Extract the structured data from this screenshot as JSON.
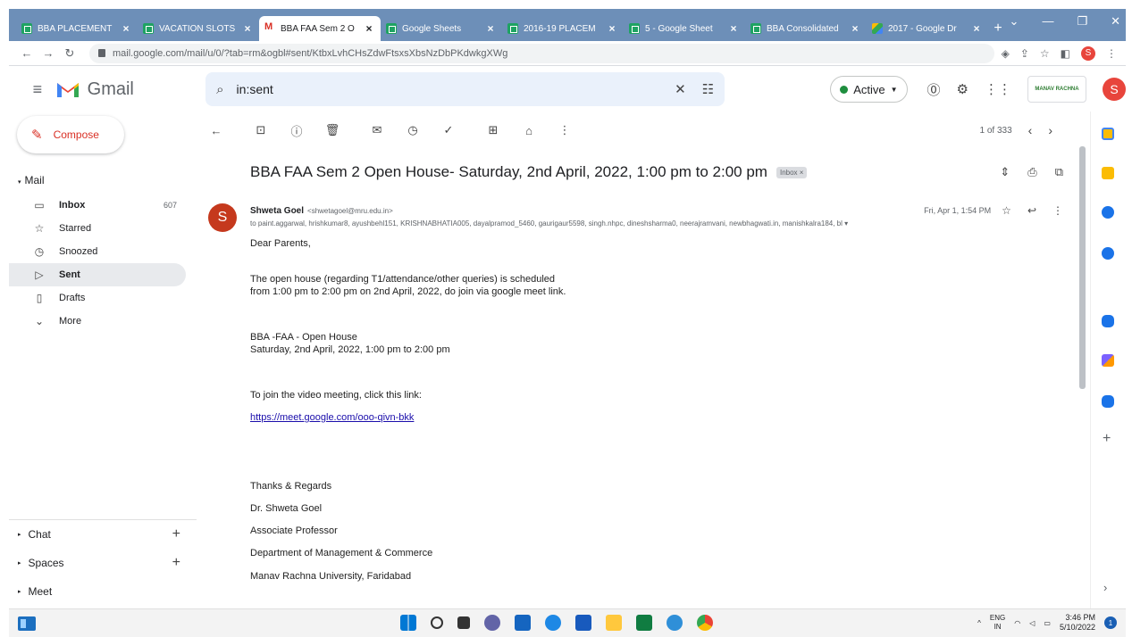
{
  "browser": {
    "tabs": [
      {
        "label": "BBA PLACEMENT",
        "icon": "sheets"
      },
      {
        "label": "VACATION SLOTS",
        "icon": "sheets"
      },
      {
        "label": "BBA FAA Sem 2 O",
        "icon": "gmail"
      },
      {
        "label": "Google Sheets",
        "icon": "sheets"
      },
      {
        "label": "2016-19 PLACEM",
        "icon": "sheets"
      },
      {
        "label": "5 - Google Sheet",
        "icon": "sheets"
      },
      {
        "label": "BBA Consolidated",
        "icon": "sheets"
      },
      {
        "label": "2017 - Google Dr",
        "icon": "drive"
      }
    ],
    "active_tab": 2,
    "new_tab": "+",
    "url": "mail.google.com/mail/u/0/?tab=rm&ogbl#sent/KtbxLvhCHsZdwFtsxsXbsNzDbPKdwkgXWg",
    "profile_initial": "S"
  },
  "gmail": {
    "app_name": "Gmail",
    "search_value": "in:sent",
    "status": "Active",
    "avatar_initial": "S",
    "org_logo_text": "MANAV RACHNA"
  },
  "sidebar": {
    "compose": "Compose",
    "mail_section": "Mail",
    "items": [
      {
        "label": "Inbox",
        "count": "607",
        "icon": "inbox-icon"
      },
      {
        "label": "Starred",
        "count": "",
        "icon": "star-icon"
      },
      {
        "label": "Snoozed",
        "count": "",
        "icon": "clock-icon"
      },
      {
        "label": "Sent",
        "count": "",
        "icon": "send-icon"
      },
      {
        "label": "Drafts",
        "count": "",
        "icon": "draft-icon"
      },
      {
        "label": "More",
        "count": "",
        "icon": "chevron-down-icon"
      }
    ],
    "bottom": [
      {
        "label": "Chat"
      },
      {
        "label": "Spaces"
      },
      {
        "label": "Meet"
      }
    ]
  },
  "toolbar": {
    "page_info": "1 of 333"
  },
  "message": {
    "subject": "BBA FAA Sem 2 Open House- Saturday, 2nd April, 2022, 1:00 pm to 2:00 pm",
    "label": "Inbox ×",
    "sender_initial": "S",
    "sender_name": "Shweta Goel",
    "sender_email": "<shwetagoel@mru.edu.in>",
    "time": "Fri, Apr 1, 1:54 PM",
    "recipients": "to paint.aggarwal, hrishkumar8, ayushbehl151, KRISHNABHATIA005, dayalpramod_5460, gaurigaur5598, singh.nhpc, dineshsharma0, neerajramvani, newbhagwati.in, manishkalra184, bl ▾",
    "greeting": "Dear Parents,",
    "para1_line1": "The open house (regarding T1/attendance/other queries) is scheduled",
    "para1_line2": "from 1:00 pm to 2:00 pm on 2nd April, 2022, do join via google meet link.",
    "event_title": "BBA -FAA - Open House",
    "event_time": "Saturday, 2nd April, 2022, 1:00 pm to 2:00 pm",
    "join_text": "To join the video meeting, click this link:",
    "meet_link": "https://meet.google.com/ooo-qivn-bkk",
    "sign_off": "Thanks & Regards",
    "sig_name": "Dr. Shweta Goel",
    "sig_title": "Associate Professor",
    "sig_dept": "Department of Management & Commerce",
    "sig_univ": "Manav Rachna University, Faridabad"
  },
  "taskbar": {
    "lang_line1": "ENG",
    "lang_line2": "IN",
    "time": "3:46 PM",
    "date": "5/10/2022",
    "notification_count": "1"
  },
  "colors": {
    "tabstrip": "#6d8fb8",
    "accent_red": "#d93025",
    "active_green": "#1e8e3e",
    "link": "#1a0dab"
  }
}
